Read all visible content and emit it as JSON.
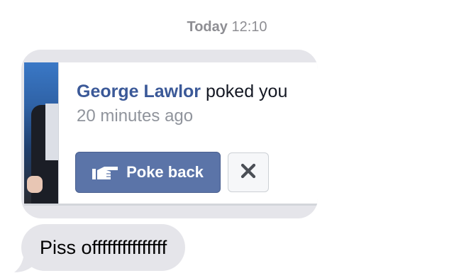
{
  "timestamp": {
    "day": "Today",
    "time": "12:10"
  },
  "notification": {
    "name": "George Lawlor",
    "action": "poked you",
    "time_ago": "20 minutes ago",
    "poke_back_label": "Poke back",
    "poke_icon": "hand-point-icon",
    "dismiss_icon": "close-icon"
  },
  "message": {
    "text": "Piss offfffffffffffff"
  },
  "colors": {
    "bubble": "#e5e5ea",
    "facebook_blue": "#3b5998",
    "button_blue": "#5b74a8"
  }
}
